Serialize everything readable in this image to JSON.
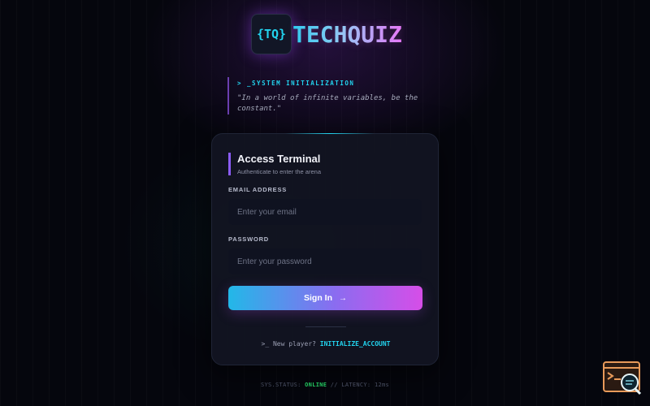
{
  "logo": {
    "badge": "{TQ}",
    "name": "TECHQUIZ"
  },
  "quote": {
    "header": "> _SYSTEM INITIALIZATION",
    "text": "\"In a world of infinite variables, be the constant.\""
  },
  "card": {
    "title": "Access Terminal",
    "subtitle": "Authenticate to enter the arena",
    "email_label": "EMAIL ADDRESS",
    "email_placeholder": "Enter your email",
    "email_value": "",
    "password_label": "PASSWORD",
    "password_placeholder": "Enter your password",
    "password_value": "",
    "signin_label": "Sign In",
    "signin_arrow": "→",
    "new_player_prefix": ">_ New player?",
    "new_player_link": "INITIALIZE_ACCOUNT"
  },
  "status": {
    "prefix": "SYS.STATUS:",
    "state": "ONLINE",
    "separator": "//",
    "latency": "LATENCY: 12ms"
  },
  "colors": {
    "accent_cyan": "#22d3ee",
    "accent_purple": "#8b5cf6",
    "accent_pink": "#d64ee8",
    "status_online": "#22c55e",
    "corner_widget": "#e89a5a"
  },
  "icons": {
    "signin": "arrow-right-icon",
    "corner": "terminal-search-icon"
  }
}
